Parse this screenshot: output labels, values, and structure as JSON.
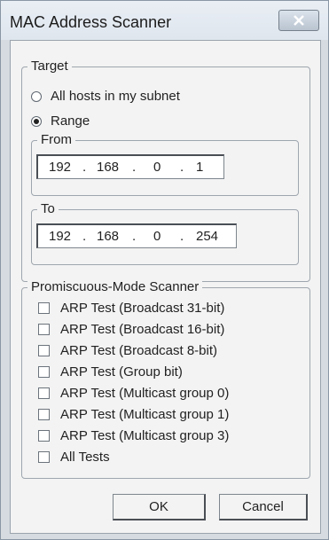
{
  "window": {
    "title": "MAC Address Scanner"
  },
  "target": {
    "legend": "Target",
    "options": [
      {
        "label": "All hosts in my subnet",
        "selected": false
      },
      {
        "label": "Range",
        "selected": true
      }
    ],
    "from": {
      "legend": "From",
      "octets": [
        "192",
        "168",
        "0",
        "1"
      ]
    },
    "to": {
      "legend": "To",
      "octets": [
        "192",
        "168",
        "0",
        "254"
      ]
    },
    "separator": "."
  },
  "promiscuous": {
    "legend": "Promiscuous-Mode Scanner",
    "tests": [
      {
        "label": "ARP Test (Broadcast 31-bit)",
        "checked": false
      },
      {
        "label": "ARP Test (Broadcast 16-bit)",
        "checked": false
      },
      {
        "label": "ARP Test (Broadcast 8-bit)",
        "checked": false
      },
      {
        "label": "ARP Test (Group bit)",
        "checked": false
      },
      {
        "label": "ARP Test (Multicast group 0)",
        "checked": false
      },
      {
        "label": "ARP Test (Multicast group 1)",
        "checked": false
      },
      {
        "label": "ARP Test (Multicast group 3)",
        "checked": false
      },
      {
        "label": "All Tests",
        "checked": false
      }
    ]
  },
  "buttons": {
    "ok": "OK",
    "cancel": "Cancel"
  }
}
